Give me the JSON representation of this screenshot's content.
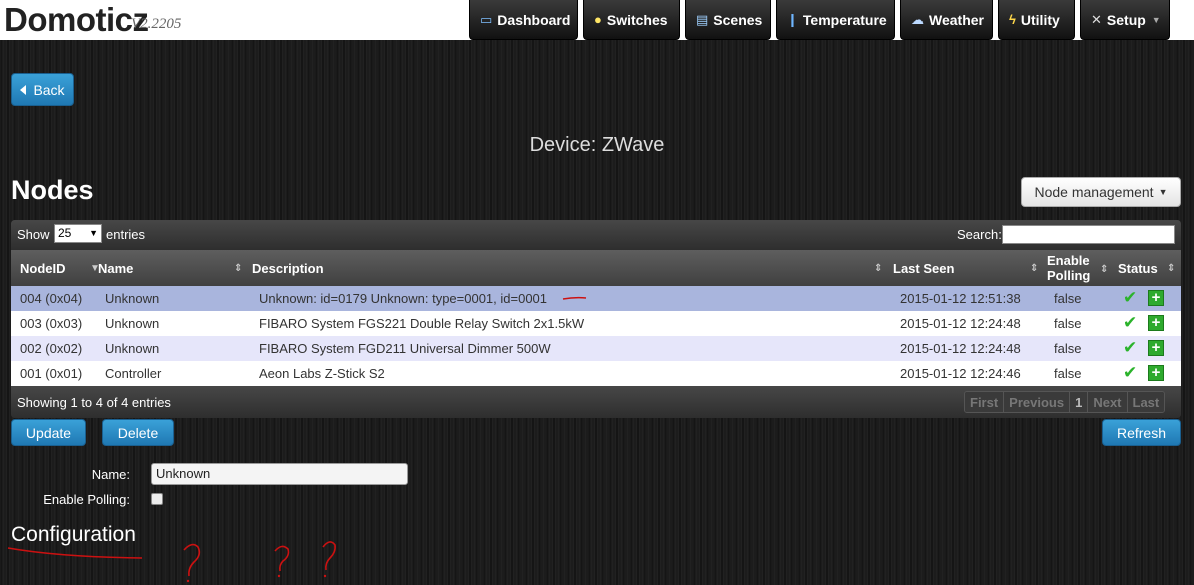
{
  "app": {
    "title": "Domoticz",
    "version": "V2.2205"
  },
  "nav": [
    {
      "label": "Dashboard",
      "icon": "monitor-icon"
    },
    {
      "label": "Switches",
      "icon": "lightbulb-icon"
    },
    {
      "label": "Scenes",
      "icon": "scenes-icon"
    },
    {
      "label": "Temperature",
      "icon": "thermometer-icon"
    },
    {
      "label": "Weather",
      "icon": "cloud-icon"
    },
    {
      "label": "Utility",
      "icon": "lightning-icon"
    },
    {
      "label": "Setup",
      "icon": "tools-icon"
    }
  ],
  "back_label": "Back",
  "device_title": "Device: ZWave",
  "nodes_title": "Nodes",
  "node_management_label": "Node management",
  "table": {
    "show_label": "Show",
    "page_size": "25",
    "entries_label": "entries",
    "search_label": "Search:",
    "columns": {
      "nodeid": "NodeID",
      "name": "Name",
      "description": "Description",
      "last_seen": "Last Seen",
      "enable_polling_line1": "Enable",
      "enable_polling_line2": "Polling",
      "status": "Status"
    },
    "rows": [
      {
        "nodeid": "004 (0x04)",
        "name": "Unknown",
        "description": "Unknown: id=0179 Unknown: type=0001, id=0001",
        "last_seen": "2015-01-12 12:51:38",
        "polling": "false"
      },
      {
        "nodeid": "003 (0x03)",
        "name": "Unknown",
        "description": "FIBARO System FGS221 Double Relay Switch 2x1.5kW",
        "last_seen": "2015-01-12 12:24:48",
        "polling": "false"
      },
      {
        "nodeid": "002 (0x02)",
        "name": "Unknown",
        "description": "FIBARO System FGD211 Universal Dimmer 500W",
        "last_seen": "2015-01-12 12:24:48",
        "polling": "false"
      },
      {
        "nodeid": "001 (0x01)",
        "name": "Controller",
        "description": "Aeon Labs Z-Stick S2",
        "last_seen": "2015-01-12 12:24:46",
        "polling": "false"
      }
    ],
    "info": "Showing 1 to 4 of 4 entries",
    "pager": {
      "first": "First",
      "previous": "Previous",
      "current": "1",
      "next": "Next",
      "last": "Last"
    }
  },
  "update_label": "Update",
  "delete_label": "Delete",
  "refresh_label": "Refresh",
  "form": {
    "name_label": "Name:",
    "name_value": "Unknown",
    "polling_label": "Enable Polling:",
    "polling_checked": false
  },
  "configuration_title": "Configuration",
  "colors": {
    "accent_blue": "#2a8ac6",
    "selected_row": "#a9b5dd",
    "alt_row": "#e6e6fa",
    "status_green": "#2bb32b",
    "annotation_red": "#cc1111"
  }
}
